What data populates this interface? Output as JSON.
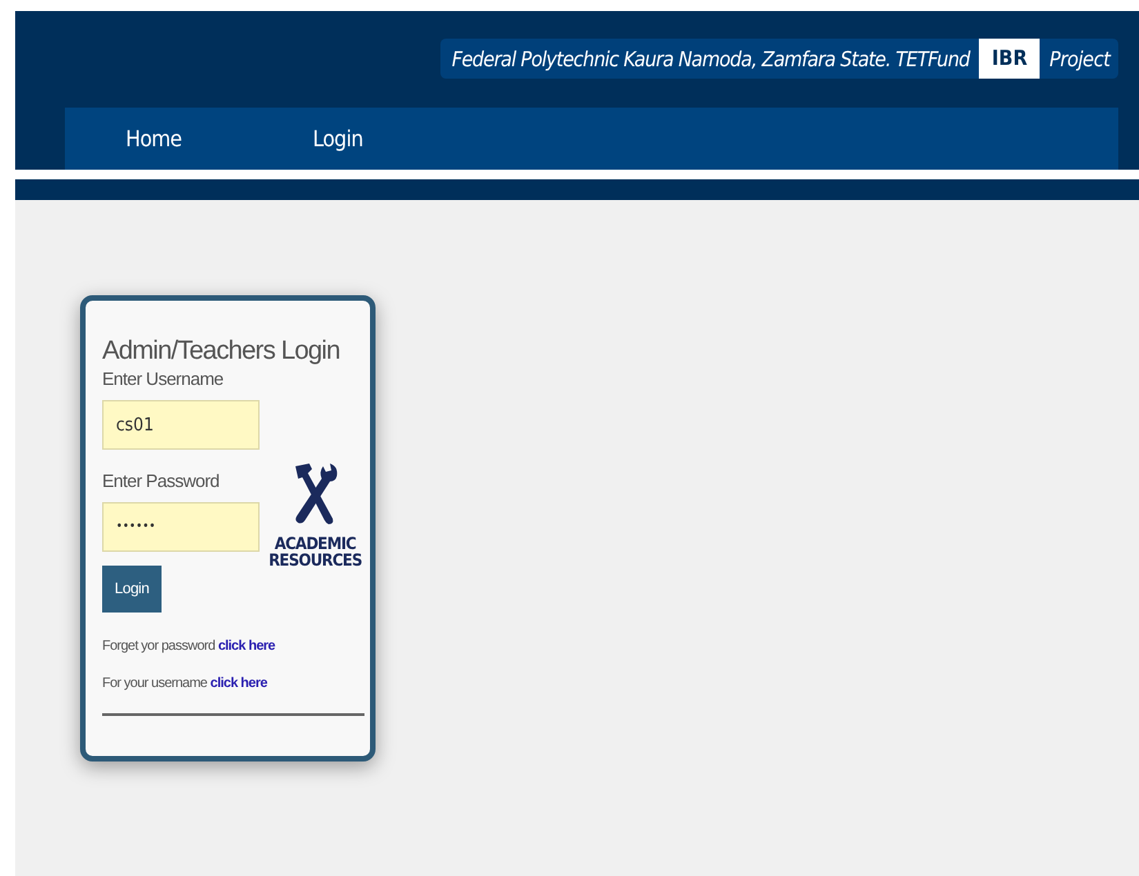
{
  "header": {
    "title": "Federal Polytechnic Kaura Namoda, Zamfara State. TETFund",
    "badge": "IBR",
    "suffix": "Project"
  },
  "nav": [
    {
      "label": "Home"
    },
    {
      "label": "Login"
    }
  ],
  "login": {
    "heading": "Admin/Teachers Login",
    "username_label": "Enter Username",
    "username_value": "cs01",
    "password_label": "Enter Password",
    "password_value": "••••••",
    "button": "Login",
    "links": [
      {
        "text": "Forget yor password",
        "link": "click here"
      },
      {
        "text": "For your username",
        "link": "click here"
      }
    ],
    "logo": [
      "ACADEMIC",
      "RESOURCES"
    ]
  }
}
